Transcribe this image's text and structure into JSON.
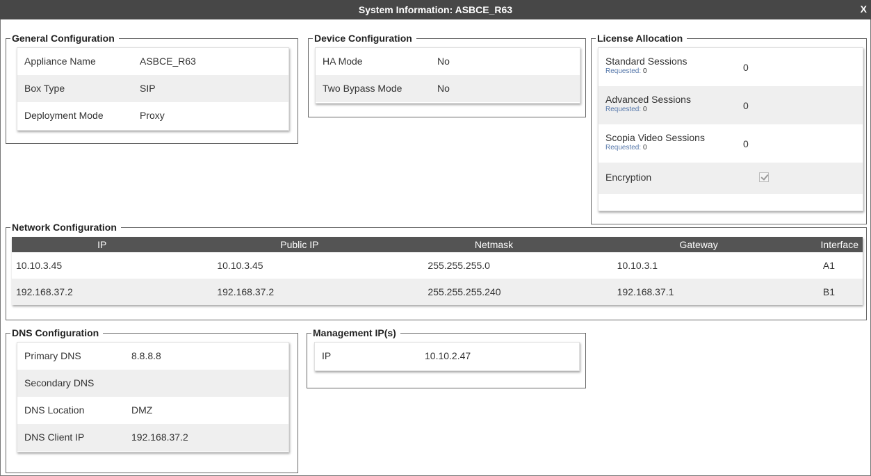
{
  "window": {
    "title": "System Information: ASBCE_R63",
    "close_label": "X"
  },
  "general": {
    "legend": "General Configuration",
    "rows": [
      {
        "label": "Appliance Name",
        "value": "ASBCE_R63"
      },
      {
        "label": "Box Type",
        "value": "SIP"
      },
      {
        "label": "Deployment Mode",
        "value": "Proxy"
      }
    ]
  },
  "device": {
    "legend": "Device Configuration",
    "rows": [
      {
        "label": "HA Mode",
        "value": "No"
      },
      {
        "label": "Two Bypass Mode",
        "value": "No"
      }
    ]
  },
  "license": {
    "legend": "License Allocation",
    "requested_label": "Requested:",
    "rows": [
      {
        "label": "Standard Sessions",
        "requested": "0",
        "value": "0"
      },
      {
        "label": "Advanced Sessions",
        "requested": "0",
        "value": "0"
      },
      {
        "label": "Scopia Video Sessions",
        "requested": "0",
        "value": "0"
      }
    ],
    "encryption": {
      "label": "Encryption",
      "checked": true
    }
  },
  "network": {
    "legend": "Network Configuration",
    "columns": [
      "IP",
      "Public IP",
      "Netmask",
      "Gateway",
      "Interface"
    ],
    "rows": [
      [
        "10.10.3.45",
        "10.10.3.45",
        "255.255.255.0",
        "10.10.3.1",
        "A1"
      ],
      [
        "192.168.37.2",
        "192.168.37.2",
        "255.255.255.240",
        "192.168.37.1",
        "B1"
      ]
    ]
  },
  "dns": {
    "legend": "DNS Configuration",
    "rows": [
      {
        "label": "Primary DNS",
        "value": "8.8.8.8"
      },
      {
        "label": "Secondary DNS",
        "value": ""
      },
      {
        "label": "DNS Location",
        "value": "DMZ"
      },
      {
        "label": "DNS Client IP",
        "value": "192.168.37.2"
      }
    ]
  },
  "management": {
    "legend": "Management IP(s)",
    "rows": [
      {
        "label": "IP",
        "value": "10.10.2.47"
      }
    ]
  },
  "colors": {
    "titlebar": "#474747",
    "table_header": "#545454",
    "row_alt": "#efefef",
    "requested_text": "#5577aa"
  },
  "icons": {
    "close": "close-icon",
    "encryption_check": "checkmark-icon"
  }
}
